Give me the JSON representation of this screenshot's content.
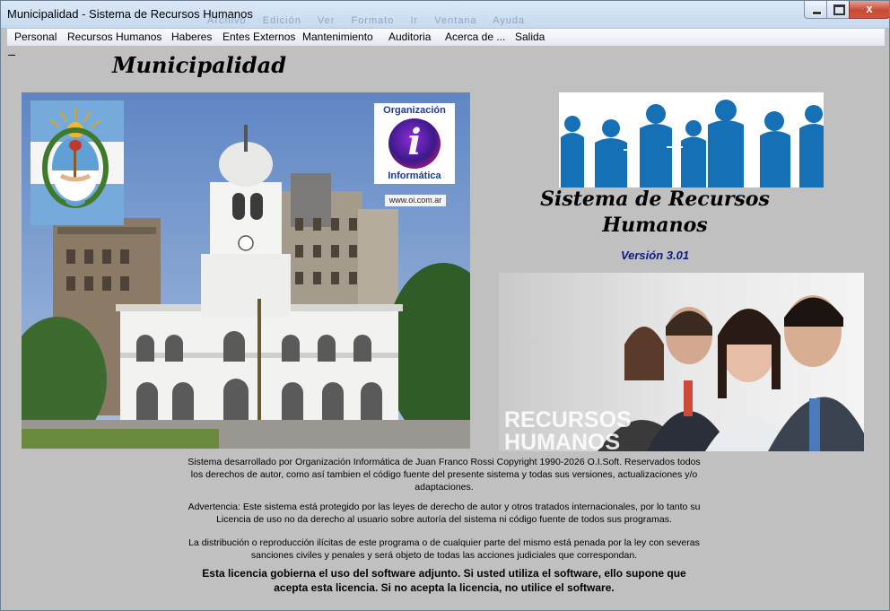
{
  "window": {
    "title": "Municipalidad - Sistema de Recursos Humanos",
    "ghost_menu": [
      "Archivo",
      "Edición",
      "Ver",
      "Formato",
      "Ir",
      "Ventana",
      "Ayuda"
    ],
    "close_glyph": "x"
  },
  "menu": {
    "items": [
      {
        "label": "Personal"
      },
      {
        "label": "Recursos Humanos"
      },
      {
        "label": "Haberes"
      },
      {
        "label": "Entes Externos"
      },
      {
        "label": "Mantenimiento"
      },
      {
        "label": "Auditoria"
      },
      {
        "label": "Acerca de ..."
      },
      {
        "label": "Salida"
      }
    ]
  },
  "header": {
    "title": "Municipalidad"
  },
  "logo": {
    "line1": "Organización",
    "letter": "i",
    "line2": "Informática",
    "url": "www.oi.com.ar"
  },
  "system": {
    "name": "Sistema de Recursos Humanos",
    "version": "Versión 3.01"
  },
  "banner": {
    "line1": "RECURSOS",
    "line2": "HUMANOS"
  },
  "legal": {
    "p1": "Sistema desarrollado por Organización Informática de Juan Franco Rossi   Copyright 1990-2026 O.I.Soft. Reservados todos los derechos de autor, como así tambien el código fuente del presente sistema y todas sus versiones, actualizaciones y/o adaptaciones.",
    "p2": "Advertencia: Este sistema está protegido por las leyes de derecho de autor y otros tratados internacionales, por lo tanto su Licencia de uso no da derecho al usuario sobre autoría del sistema ni código fuente de todos sus programas.",
    "p3": "La distribución o reproducción ilícitas de este programa o de cualquier parte del mismo está penada por la ley con severas sanciones civiles y penales y será objeto de todas las acciones judiciales que correspondan.",
    "p4": "Esta licencia gobierna el uso del software adjunto. Si usted utiliza el software, ello supone que acepta esta licencia. Si no acepta la licencia, no utilice el software."
  }
}
